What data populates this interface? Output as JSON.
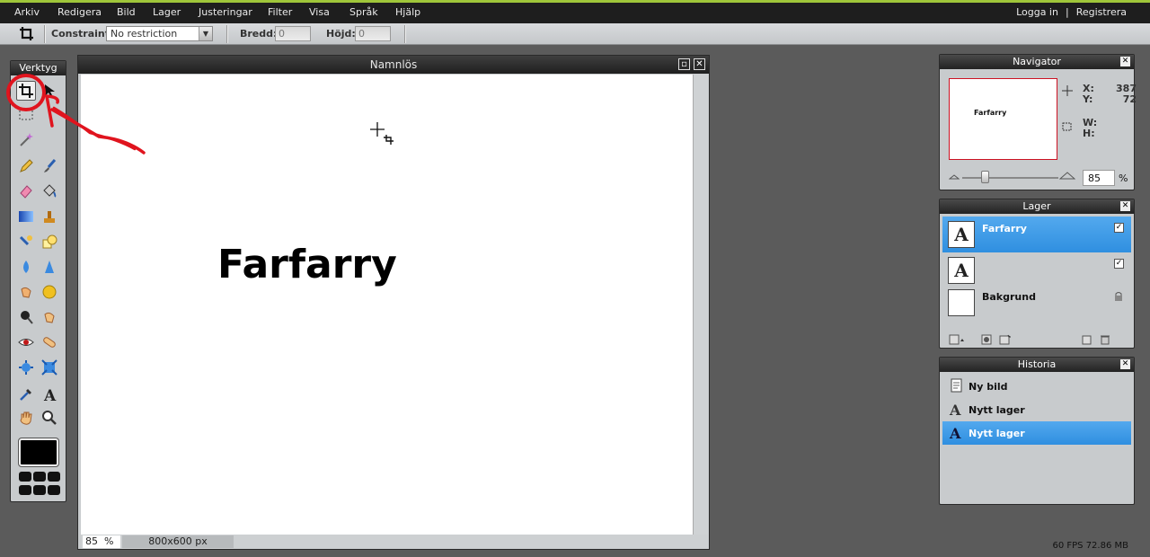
{
  "menu": {
    "items": [
      "Arkiv",
      "Redigera",
      "Bild",
      "Lager",
      "Justeringar",
      "Filter",
      "Visa",
      "Språk",
      "Hjälp"
    ],
    "login": "Logga in",
    "separator": "|",
    "register": "Registrera"
  },
  "options": {
    "constraint_label": "Constraint:",
    "constraint_value": "No restriction",
    "width_label": "Bredd:",
    "width_value": "0",
    "height_label": "Höjd:",
    "height_value": "0"
  },
  "tools": {
    "title": "Verktyg",
    "selected": "crop-tool"
  },
  "canvas_window": {
    "title": "Namnlös",
    "canvas_text": "Farfarry",
    "zoom": "85",
    "zoom_unit": "%",
    "size": "800x600 px"
  },
  "navigator": {
    "title": "Navigator",
    "thumb_text": "Farfarry",
    "x_label": "X:",
    "x_value": "387",
    "y_label": "Y:",
    "y_value": "72",
    "w_label": "W:",
    "h_label": "H:",
    "zoom_value": "85",
    "zoom_unit": "%"
  },
  "layers": {
    "title": "Lager",
    "items": [
      {
        "name": "Farfarry",
        "thumb": "A",
        "selected": true,
        "visible": true
      },
      {
        "name": "",
        "thumb": "A",
        "selected": false,
        "visible": true
      },
      {
        "name": "Bakgrund",
        "thumb": "",
        "selected": false,
        "locked": true
      }
    ]
  },
  "history": {
    "title": "Historia",
    "items": [
      {
        "label": "Ny bild",
        "icon": "new-image-icon"
      },
      {
        "label": "Nytt lager",
        "icon": "text-layer-icon"
      },
      {
        "label": "Nytt lager",
        "icon": "text-layer-icon",
        "selected": true
      }
    ]
  },
  "status": {
    "fps": "60 FPS 72.86 MB"
  },
  "colors": {
    "accent_selected": "#3b9be8",
    "annotation": "#e0141e"
  }
}
